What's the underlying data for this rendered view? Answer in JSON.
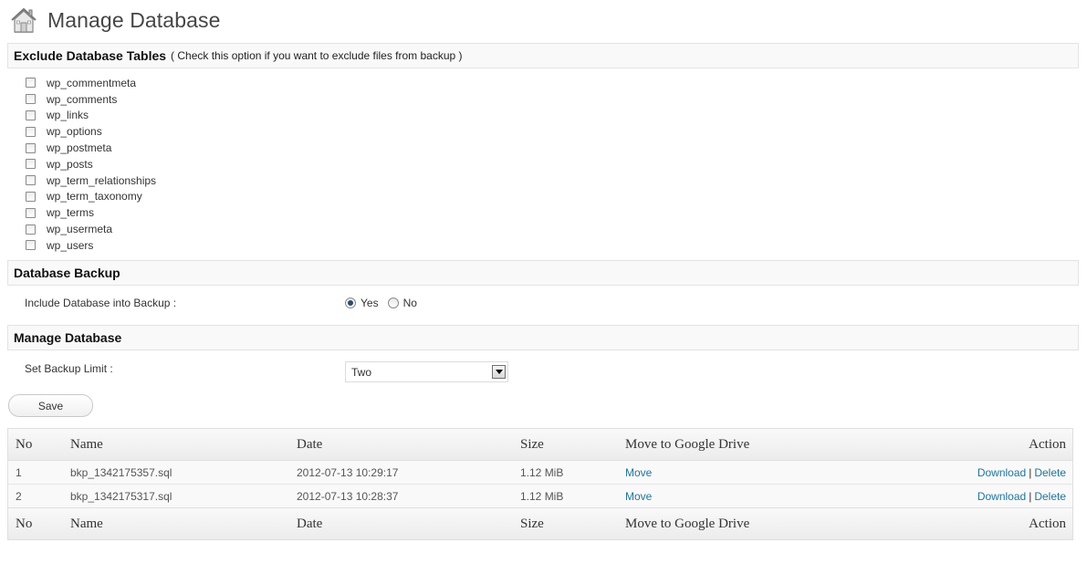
{
  "header": {
    "title": "Manage Database",
    "icon": "home-icon"
  },
  "exclude": {
    "title": "Exclude Database Tables",
    "note": "( Check this option if you want to exclude files from backup )",
    "tables": [
      "wp_commentmeta",
      "wp_comments",
      "wp_links",
      "wp_options",
      "wp_postmeta",
      "wp_posts",
      "wp_term_relationships",
      "wp_term_taxonomy",
      "wp_terms",
      "wp_usermeta",
      "wp_users"
    ]
  },
  "backup": {
    "title": "Database Backup",
    "label": "Include Database into Backup :",
    "yes_label": "Yes",
    "no_label": "No",
    "selected": "Yes"
  },
  "manage": {
    "title": "Manage Database",
    "limit_label": "Set Backup Limit :",
    "limit_value": "Two",
    "save_label": "Save"
  },
  "grid": {
    "columns": {
      "no": "No",
      "name": "Name",
      "date": "Date",
      "size": "Size",
      "move": "Move to Google Drive",
      "action": "Action"
    },
    "rows": [
      {
        "no": "1",
        "name": "bkp_1342175357.sql",
        "date": "2012-07-13 10:29:17",
        "size": "1.12 MiB",
        "move": "Move",
        "download": "Download",
        "separator": "|",
        "delete": "Delete"
      },
      {
        "no": "2",
        "name": "bkp_1342175317.sql",
        "date": "2012-07-13 10:28:37",
        "size": "1.12 MiB",
        "move": "Move",
        "download": "Download",
        "separator": "|",
        "delete": "Delete"
      }
    ]
  },
  "colors": {
    "link": "#21759b",
    "section_bg": "#f9f9f9",
    "border": "#dfdfdf"
  }
}
